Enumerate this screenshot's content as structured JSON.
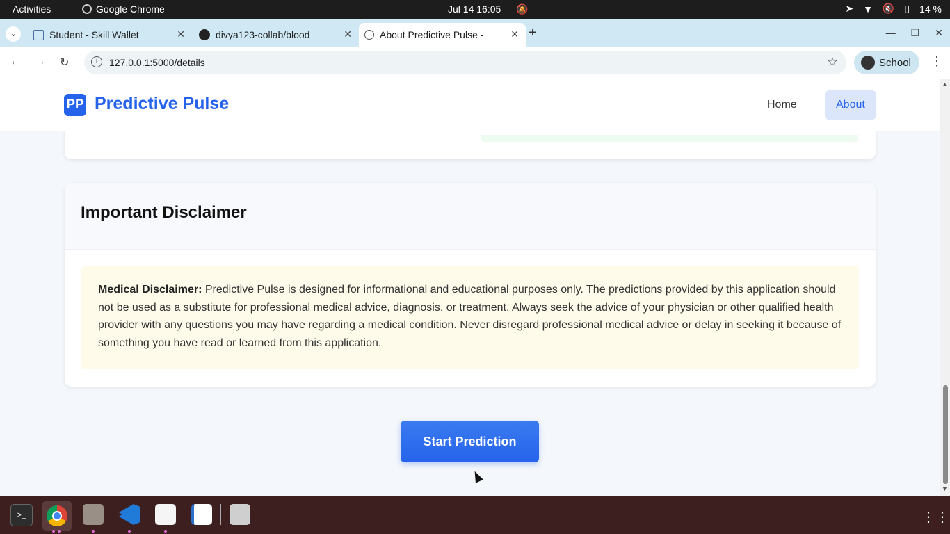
{
  "system_bar": {
    "activities": "Activities",
    "app_name": "Google Chrome",
    "clock": "Jul 14  16:05",
    "battery": "14 %"
  },
  "tabs": [
    {
      "title": "Student - Skill Wallet",
      "icon": "wallet-icon"
    },
    {
      "title": "divya123-collab/blood",
      "icon": "github-icon"
    },
    {
      "title": "About Predictive Pulse -",
      "icon": "globe-icon",
      "active": true
    }
  ],
  "address_bar": {
    "url": "127.0.0.1:5000/details",
    "profile": "School"
  },
  "site": {
    "logo_text": "PP",
    "brand": "Predictive Pulse",
    "nav": {
      "home": "Home",
      "about": "About"
    }
  },
  "disclaimer": {
    "heading": "Important Disclaimer",
    "label": "Medical Disclaimer:",
    "text": " Predictive Pulse is designed for informational and educational purposes only. The predictions provided by this application should not be used as a substitute for professional medical advice, diagnosis, or treatment. Always seek the advice of your physician or other qualified health provider with any questions you may have regarding a medical condition. Never disregard professional medical advice or delay in seeking it because of something you have read or learned from this application."
  },
  "cta": {
    "label": "Start Prediction"
  },
  "colors": {
    "brand": "#2563eb",
    "warning_bg": "#fffbeb",
    "dock_bg": "#3e1f1f"
  }
}
